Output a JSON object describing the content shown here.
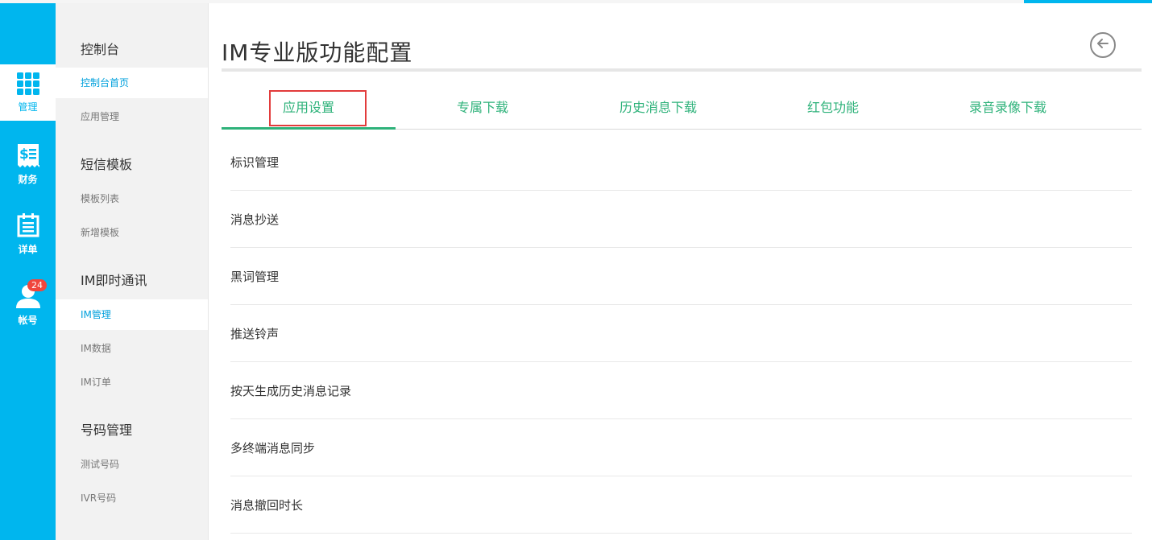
{
  "rail": {
    "items": [
      {
        "label": "管理",
        "icon": "grid-icon",
        "active": true
      },
      {
        "label": "财务",
        "icon": "bill-icon"
      },
      {
        "label": "详单",
        "icon": "calendar-list-icon"
      },
      {
        "label": "帐号",
        "icon": "user-icon",
        "badge": "24"
      }
    ]
  },
  "sidebar": {
    "groups": [
      {
        "title": "控制台",
        "items": [
          "控制台首页",
          "应用管理"
        ]
      },
      {
        "title": "短信模板",
        "items": [
          "模板列表",
          "新增模板"
        ]
      },
      {
        "title": "IM即时通讯",
        "items": [
          "IM管理",
          "IM数据",
          "IM订单"
        ]
      },
      {
        "title": "号码管理",
        "items": [
          "测试号码",
          "IVR号码"
        ]
      }
    ]
  },
  "main": {
    "title": "IM专业版功能配置",
    "tabs": [
      "应用设置",
      "专属下载",
      "历史消息下载",
      "红包功能",
      "录音录像下载"
    ],
    "rows": [
      "标识管理",
      "消息抄送",
      "黑词管理",
      "推送铃声",
      "按天生成历史消息记录",
      "多终端消息同步",
      "消息撤回时长"
    ]
  },
  "colors": {
    "rail": "#00b6ee",
    "tab_accent": "#2eb27a",
    "highlight": "#e23b3b",
    "badge": "#f0463c"
  }
}
